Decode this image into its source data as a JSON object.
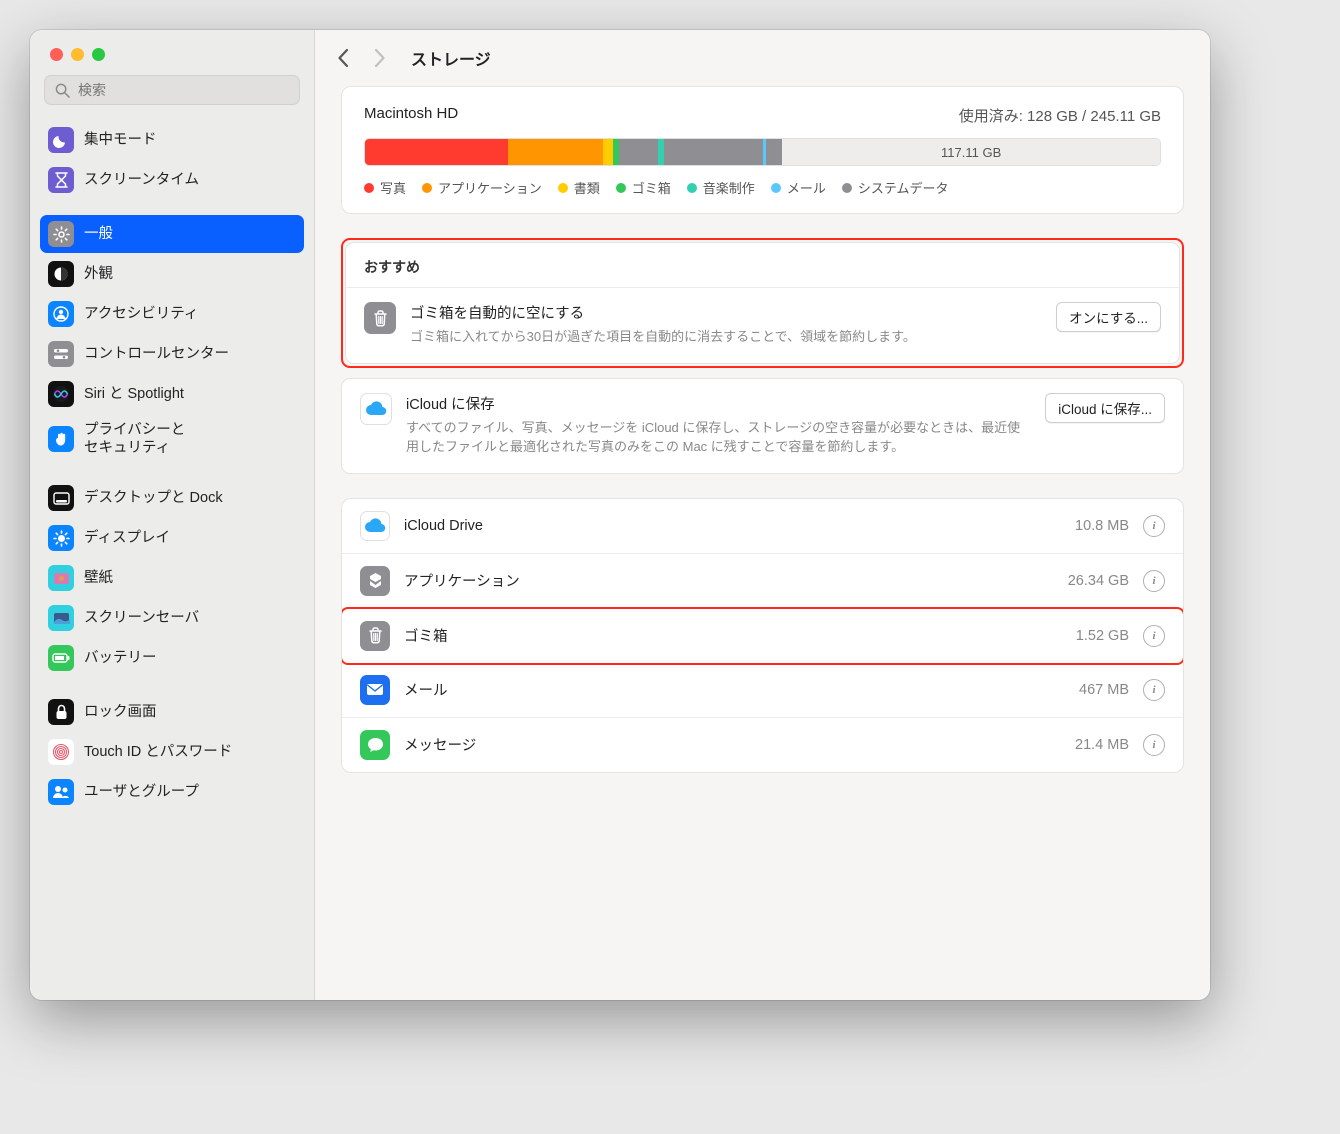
{
  "search": {
    "placeholder": "検索"
  },
  "sidebar": {
    "items": [
      {
        "label": "集中モード",
        "icon": "moon",
        "bg": "#6e5dd1"
      },
      {
        "label": "スクリーンタイム",
        "icon": "hourglass",
        "bg": "#6e5dd1"
      },
      {
        "sep": true
      },
      {
        "label": "一般",
        "icon": "gear",
        "bg": "#8e8e93",
        "active": true
      },
      {
        "label": "外観",
        "icon": "contrast",
        "bg": "#111"
      },
      {
        "label": "アクセシビリティ",
        "icon": "person",
        "bg": "#0a84ff"
      },
      {
        "label": "コントロールセンター",
        "icon": "sliders",
        "bg": "#8e8e93"
      },
      {
        "label": "Siri と Spotlight",
        "icon": "siri",
        "bg": "#111"
      },
      {
        "label": "プライバシーと\nセキュリティ",
        "icon": "hand",
        "bg": "#0a84ff"
      },
      {
        "sep": true
      },
      {
        "label": "デスクトップと Dock",
        "icon": "dock",
        "bg": "#111"
      },
      {
        "label": "ディスプレイ",
        "icon": "sun",
        "bg": "#0a84ff"
      },
      {
        "label": "壁紙",
        "icon": "wallpaper",
        "bg": "#30d0e0"
      },
      {
        "label": "スクリーンセーバ",
        "icon": "screensaver",
        "bg": "#30d0e0"
      },
      {
        "label": "バッテリー",
        "icon": "battery",
        "bg": "#34c759"
      },
      {
        "sep": true
      },
      {
        "label": "ロック画面",
        "icon": "lock",
        "bg": "#111"
      },
      {
        "label": "Touch ID とパスワード",
        "icon": "fingerprint",
        "bg": "#fff"
      },
      {
        "label": "ユーザとグループ",
        "icon": "users",
        "bg": "#0a84ff"
      }
    ]
  },
  "nav": {
    "title": "ストレージ"
  },
  "storage": {
    "disk_name": "Macintosh HD",
    "usage_label": "使用済み: 128 GB / 245.11 GB",
    "free_label": "117.11 GB",
    "segments": [
      {
        "color": "#ff3b30",
        "pct": 18
      },
      {
        "color": "#ff9500",
        "pct": 12
      },
      {
        "color": "#ffcc00",
        "pct": 1.2
      },
      {
        "color": "#34c759",
        "pct": 0.7
      },
      {
        "color": "#8e8e93",
        "pct": 5
      },
      {
        "color": "#30d0b0",
        "pct": 0.7
      },
      {
        "color": "#8e8e93",
        "pct": 12.5
      },
      {
        "color": "#5ac8fa",
        "pct": 0.4
      },
      {
        "color": "#8e8e93",
        "pct": 2
      }
    ],
    "legend": [
      {
        "color": "#ff3b30",
        "label": "写真"
      },
      {
        "color": "#ff9500",
        "label": "アプリケーション"
      },
      {
        "color": "#ffcc00",
        "label": "書類"
      },
      {
        "color": "#34c759",
        "label": "ゴミ箱"
      },
      {
        "color": "#30d0b0",
        "label": "音楽制作"
      },
      {
        "color": "#5ac8fa",
        "label": "メール"
      },
      {
        "color": "#8e8e93",
        "label": "システムデータ"
      }
    ]
  },
  "recommend": {
    "heading": "おすすめ",
    "items": [
      {
        "title": "ゴミ箱を自動的に空にする",
        "desc": "ゴミ箱に入れてから30日が過ぎた項目を自動的に消去することで、領域を節約します。",
        "button": "オンにする...",
        "icon": "trash",
        "bg": "#8e8e93",
        "fg": "#fff"
      },
      {
        "title": "iCloud に保存",
        "desc": "すべてのファイル、写真、メッセージを iCloud に保存し、ストレージの空き容量が必要なときは、最近使用したファイルと最適化された写真のみをこの Mac に残すことで容量を節約します。",
        "button": "iCloud に保存...",
        "icon": "cloud",
        "bg": "#fff",
        "fg": "#2aa8f5"
      }
    ]
  },
  "categories": [
    {
      "label": "iCloud Drive",
      "size": "10.8 MB",
      "icon": "cloud",
      "bg": "#fff",
      "fg": "#2aa8f5"
    },
    {
      "label": "アプリケーション",
      "size": "26.34 GB",
      "icon": "app",
      "bg": "#8e8e93",
      "fg": "#fff"
    },
    {
      "label": "ゴミ箱",
      "size": "1.52 GB",
      "icon": "trash",
      "bg": "#8e8e93",
      "fg": "#fff",
      "highlight": true
    },
    {
      "label": "メール",
      "size": "467 MB",
      "icon": "mail",
      "bg": "#1e6ff0",
      "fg": "#fff"
    },
    {
      "label": "メッセージ",
      "size": "21.4 MB",
      "icon": "message",
      "bg": "#34c759",
      "fg": "#fff"
    }
  ]
}
